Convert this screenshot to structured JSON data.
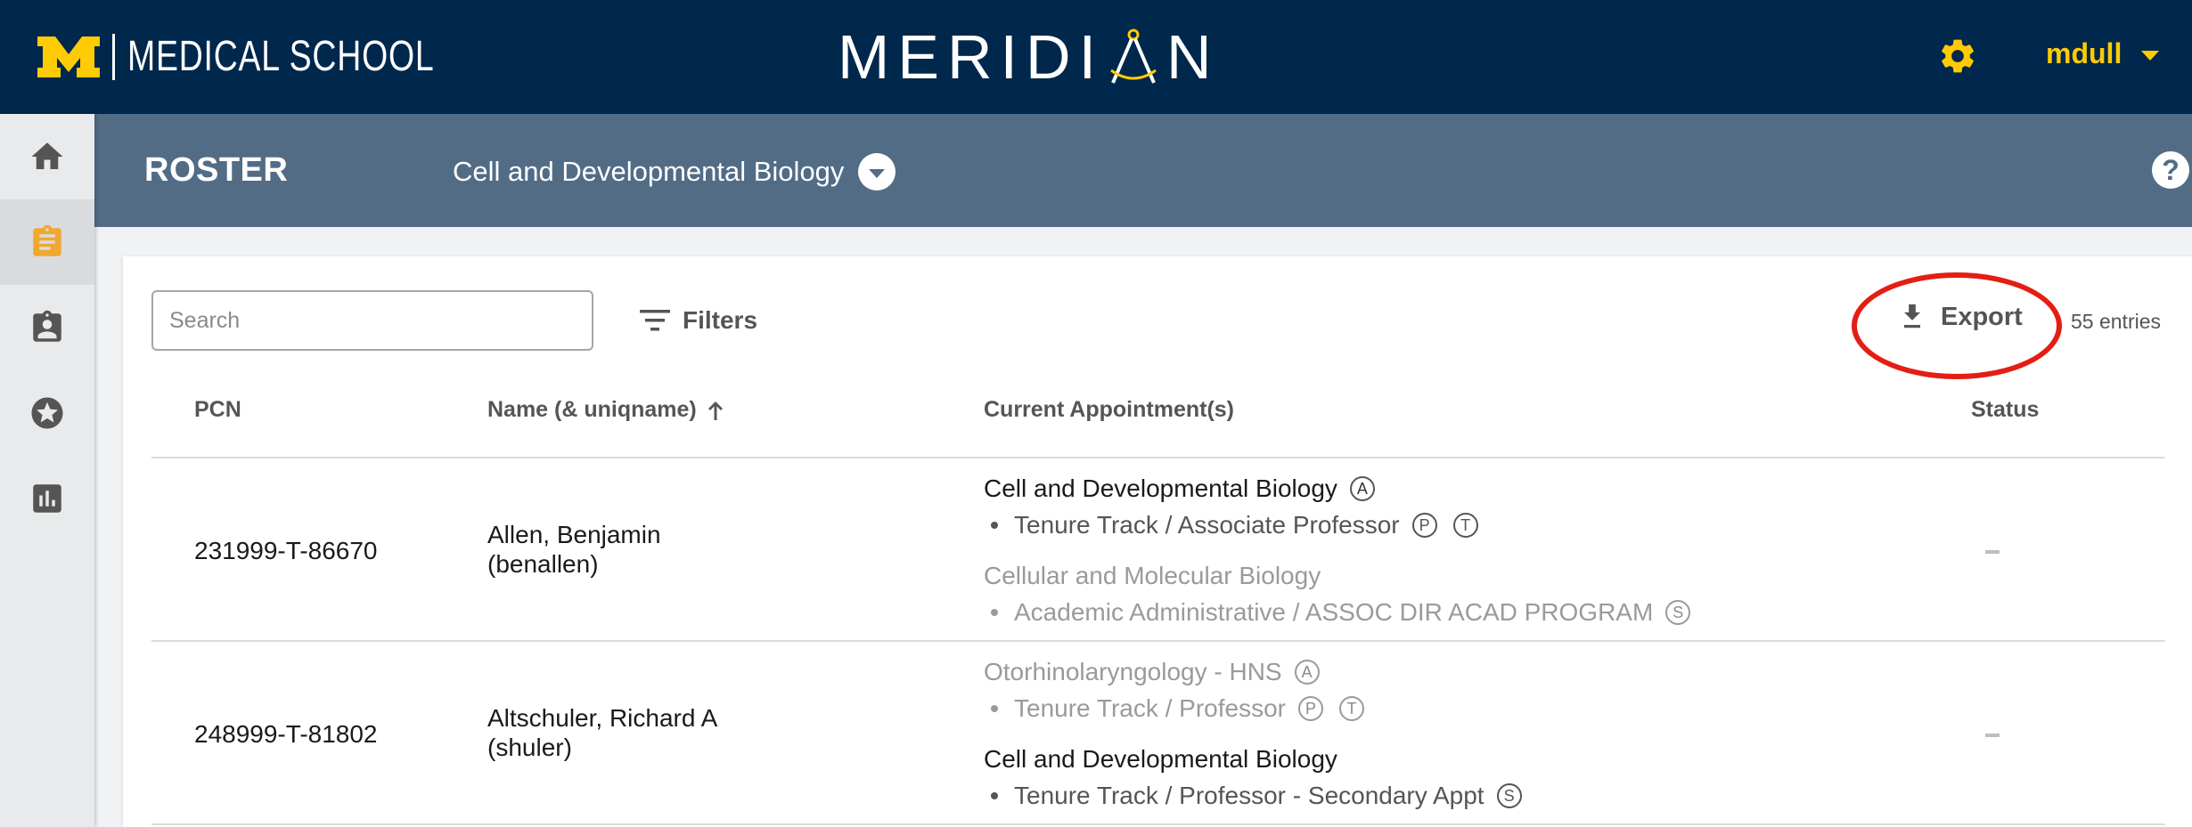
{
  "header": {
    "brand_text": "MEDICAL SCHOOL",
    "logo_text_left": "MERID",
    "logo_text_mid": "I",
    "logo_text_right": "N",
    "user_name": "mdull",
    "brand_color": "#00274c",
    "accent_color": "#ffcb05"
  },
  "sidebar": {
    "items": [
      {
        "icon": "home-icon",
        "active": false
      },
      {
        "icon": "clipboard-icon",
        "active": true
      },
      {
        "icon": "badge-icon",
        "active": false
      },
      {
        "icon": "star-icon",
        "active": false
      },
      {
        "icon": "chart-icon",
        "active": false
      }
    ]
  },
  "subheader": {
    "title": "ROSTER",
    "department": "Cell and Developmental Biology",
    "help_label": "?"
  },
  "toolbar": {
    "search_placeholder": "Search",
    "filters_label": "Filters",
    "export_label": "Export",
    "entry_count": "55 entries"
  },
  "table": {
    "columns": {
      "pcn": "PCN",
      "name": "Name (& uniqname)",
      "appointments": "Current Appointment(s)",
      "status": "Status"
    },
    "rows": [
      {
        "pcn": "231999-T-86670",
        "name": "Allen, Benjamin",
        "uniqname": "(benallen)",
        "appointments": [
          {
            "department": "Cell and Developmental Biology",
            "dept_badges": [
              "A"
            ],
            "role": "Tenure Track / Associate Professor",
            "role_badges": [
              "P",
              "T"
            ],
            "muted": false
          },
          {
            "department": "Cellular and Molecular Biology",
            "dept_badges": [],
            "role": "Academic Administrative / ASSOC DIR ACAD PROGRAM",
            "role_badges": [
              "S"
            ],
            "muted": true
          }
        ],
        "status": "–"
      },
      {
        "pcn": "248999-T-81802",
        "name": "Altschuler, Richard A",
        "uniqname": "(shuler)",
        "appointments": [
          {
            "department": "Otorhinolaryngology - HNS",
            "dept_badges": [
              "A"
            ],
            "role": "Tenure Track / Professor",
            "role_badges": [
              "P",
              "T"
            ],
            "muted": true
          },
          {
            "department": "Cell and Developmental Biology",
            "dept_badges": [],
            "role": "Tenure Track / Professor - Secondary Appt",
            "role_badges": [
              "S"
            ],
            "muted": false
          }
        ],
        "status": "–"
      }
    ]
  }
}
